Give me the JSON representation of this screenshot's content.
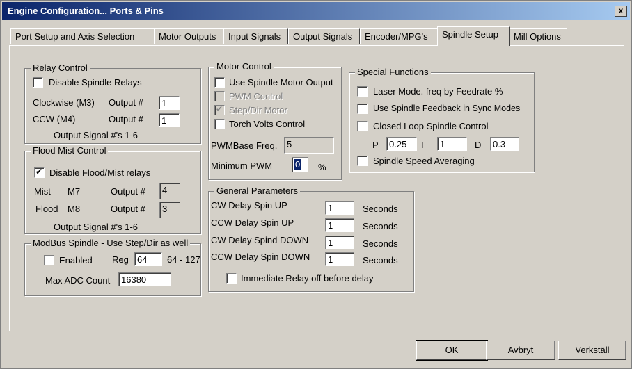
{
  "window": {
    "title": "Engine Configuration... Ports & Pins",
    "close": "x"
  },
  "tabs": [
    "Port Setup and Axis Selection",
    "Motor Outputs",
    "Input Signals",
    "Output Signals",
    "Encoder/MPG's",
    "Spindle Setup",
    "Mill Options"
  ],
  "active_tab": "Spindle Setup",
  "relay": {
    "title": "Relay Control",
    "disable": "Disable Spindle Relays",
    "disable_checked": false,
    "cw_label": "Clockwise (M3)",
    "ccw_label": "CCW (M4)",
    "output_label": "Output #",
    "cw_value": "1",
    "ccw_value": "1",
    "signals": "Output Signal #'s 1-6"
  },
  "flood": {
    "title": "Flood Mist Control",
    "disable": "Disable Flood/Mist relays",
    "disable_checked": true,
    "mist": "Mist",
    "mist_code": "M7",
    "flood": "Flood",
    "flood_code": "M8",
    "output_label": "Output #",
    "mist_value": "4",
    "flood_value": "3",
    "signals": "Output Signal #'s 1-6"
  },
  "modbus": {
    "title": "ModBus Spindle - Use Step/Dir as well",
    "enabled": "Enabled",
    "enabled_checked": false,
    "reg_label": "Reg",
    "reg_value": "64",
    "range": "64 - 127",
    "max_adc_label": "Max ADC Count",
    "max_adc_value": "16380"
  },
  "motor": {
    "title": "Motor Control",
    "use_spindle_motor": "Use Spindle Motor Output",
    "pwm_control": "PWM Control",
    "step_dir": "Step/Dir Motor",
    "torch_volts": "Torch Volts Control",
    "pwm_base_label": "PWMBase Freq.",
    "pwm_base_value": "5",
    "min_pwm_label": "Minimum PWM",
    "min_pwm_value": "0",
    "percent": "%"
  },
  "special": {
    "title": "Special Functions",
    "laser": "Laser Mode. freq by Feedrate %",
    "feedback": "Use Spindle Feedback in Sync Modes",
    "closed_loop": "Closed Loop Spindle Control",
    "p_label": "P",
    "p_value": "0.25",
    "i_label": "I",
    "i_value": "1",
    "d_label": "D",
    "d_value": "0.3",
    "averaging": "Spindle Speed Averaging"
  },
  "general": {
    "title": "General Parameters",
    "rows": [
      {
        "label": "CW Delay Spin UP",
        "value": "1",
        "unit": "Seconds"
      },
      {
        "label": "CCW Delay Spin UP",
        "value": "1",
        "unit": "Seconds"
      },
      {
        "label": "CW Delay Spind DOWN",
        "value": "1",
        "unit": "Seconds"
      },
      {
        "label": "CCW Delay Spin DOWN",
        "value": "1",
        "unit": "Seconds"
      }
    ],
    "immediate": "Immediate Relay off before delay"
  },
  "buttons": {
    "ok": "OK",
    "cancel": "Avbryt",
    "apply": "Verkställ"
  }
}
